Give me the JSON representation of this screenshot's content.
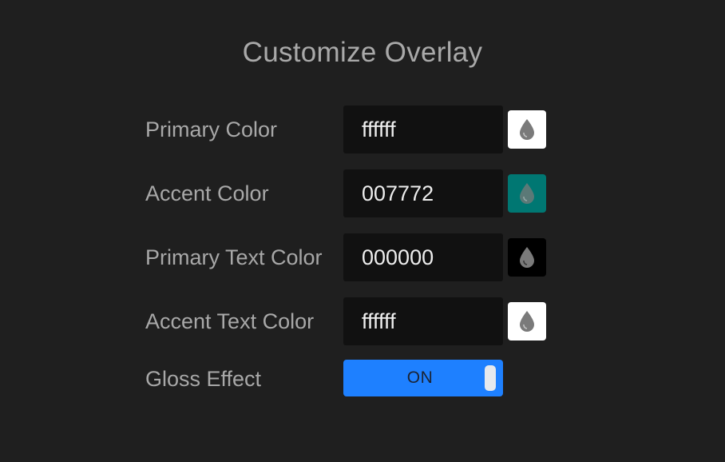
{
  "header": {
    "title": "Customize Overlay"
  },
  "colors": {
    "page_background": "#1f1f1f",
    "field_background": "#111111",
    "label_color": "#a8a8a8",
    "toggle_on": "#1e80ff",
    "icon_gray": "#7a7a7a"
  },
  "fields": {
    "primary_color": {
      "label": "Primary Color",
      "value": "ffffff",
      "swatch_color": "#ffffff",
      "icon": "droplet-icon"
    },
    "accent_color": {
      "label": "Accent Color",
      "value": "007772",
      "swatch_color": "#007772",
      "icon": "droplet-icon"
    },
    "primary_text_color": {
      "label": "Primary Text Color",
      "value": "000000",
      "swatch_color": "#000000",
      "icon": "droplet-icon"
    },
    "accent_text_color": {
      "label": "Accent Text Color",
      "value": "ffffff",
      "swatch_color": "#ffffff",
      "icon": "droplet-icon"
    }
  },
  "gloss": {
    "label": "Gloss Effect",
    "state_text": "ON",
    "enabled": true
  }
}
